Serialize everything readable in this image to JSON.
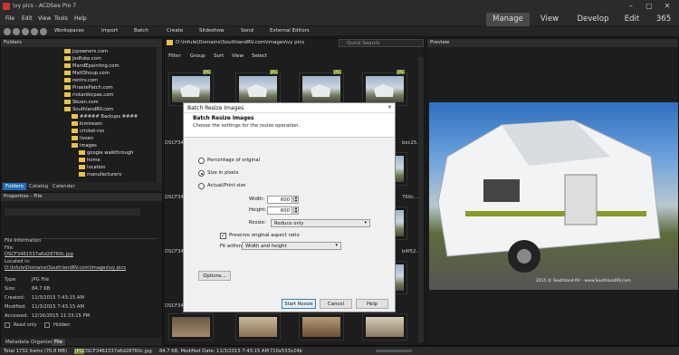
{
  "window": {
    "title": "\\vy pics - ACDSee Pro 7",
    "min": "–",
    "max": "▢",
    "close": "✕"
  },
  "menu": [
    "File",
    "Edit",
    "View",
    "Tools",
    "Help"
  ],
  "modes": [
    "Manage",
    "View",
    "Develop",
    "Edit",
    "365"
  ],
  "toolbar": {
    "items": [
      "Workspaces",
      "Import",
      "Batch",
      "Create",
      "Slideshow",
      "Send",
      "External Editors"
    ]
  },
  "folders": {
    "title": "Folders",
    "items": [
      "jcpowners.com",
      "Jedfuke.com",
      "MandEpainting.com",
      "MattShoup.com",
      "rentrv.com",
      "PirastePatch.com",
      "rickardscpas.com",
      "Skuen.com",
      "SouthlandRV.com",
      "##### Backups ####",
      "kimtream",
      "cricket-rvs",
      "livsen",
      "images",
      "google walkthrough",
      "home",
      "location",
      "manufacturers"
    ],
    "tabs": [
      "Folders",
      "Catalog",
      "Calendar"
    ]
  },
  "properties": {
    "title": "Properties - File",
    "section": "File Information",
    "file_label": "File:",
    "file_value": "DSCF3461537a6d28760c.jpg",
    "located_label": "Located in:",
    "located_value": "D:\\Infule\\Domains\\SouthlandRV.com\\images\\vy pics",
    "rows": [
      {
        "label": "Type:",
        "value": "JPG File"
      },
      {
        "label": "Size:",
        "value": "84.7 KB"
      },
      {
        "label": "Created:",
        "value": "11/3/2015 7:43:15 AM"
      },
      {
        "label": "Modified:",
        "value": "11/3/2015 7:43:15 AM"
      },
      {
        "label": "Accessed:",
        "value": "12/16/2015 11:33:15 PM"
      }
    ],
    "readonly": "Read only",
    "hidden": "Hidden",
    "tabs": [
      "Metadata",
      "Organize",
      "File"
    ]
  },
  "browser": {
    "path": "D:\\Infule\\Domains\\SouthlandRV.com\\images\\vy pics",
    "search_placeholder": "Quick Search",
    "filters": [
      "Filter",
      "Group",
      "Sort",
      "View",
      "Select"
    ],
    "badge": "JPG",
    "captions": [
      "DSCF34",
      "DSCF34",
      "DSCF34",
      "DSCF34"
    ],
    "right_captions": [
      "bec25...",
      "760c...",
      "b4f52..."
    ]
  },
  "preview": {
    "title": "Preview",
    "watermark": "2015 © Southland RV - www.SouthlandRV.com"
  },
  "dialog": {
    "title": "Batch Resize Images",
    "close": "✕",
    "heading": "Batch Resize Images",
    "subheading": "Choose the settings for the resize operation.",
    "options": [
      "Percentage of original",
      "Size in pixels",
      "Actual/Print size"
    ],
    "width_label": "Width:",
    "width_value": "600",
    "height_label": "Height:",
    "height_value": "600",
    "resize_label": "Resize:",
    "resize_value": "Reduce only",
    "preserve_label": "Preserve original aspect ratio",
    "fitwithin_label": "Fit within:",
    "fitwithin_value": "Width and height",
    "options_btn": "Options...",
    "start_btn": "Start Resize",
    "cancel_btn": "Cancel",
    "help_btn": "Help"
  },
  "status": {
    "total": "Total 1732 items  (70.8 MB)",
    "jpg": "JPG",
    "filename": "DSCF3461537a6d28760c.jpg",
    "modified": "84.7 KB, Modified Date: 11/3/2015 7:43:15 AM",
    "dims": "710x533x24b"
  },
  "colors": {
    "accent_folder": "#e6c34a",
    "selected_tab": "#1e6fb8",
    "jpg_badge": "#6b8f2a"
  }
}
